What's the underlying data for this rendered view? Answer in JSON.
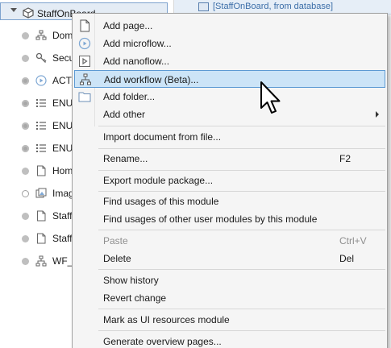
{
  "tree": {
    "root_label": "StaffOnBoard",
    "items": [
      {
        "label": "Dom",
        "icon": "domain-model-icon",
        "bullet": "gray"
      },
      {
        "label": "Secu",
        "icon": "security-key-icon",
        "bullet": "gray"
      },
      {
        "label": "ACT_",
        "icon": "microflow-icon",
        "bullet": "dark"
      },
      {
        "label": "ENU",
        "icon": "enumeration-icon",
        "bullet": "dark"
      },
      {
        "label": "ENU",
        "icon": "enumeration-icon",
        "bullet": "dark"
      },
      {
        "label": "ENU",
        "icon": "enumeration-icon",
        "bullet": "dark"
      },
      {
        "label": "Hom",
        "icon": "page-icon",
        "bullet": "gray"
      },
      {
        "label": "Imag",
        "icon": "image-collection-icon",
        "bullet": "hollow"
      },
      {
        "label": "Staff",
        "icon": "page-icon",
        "bullet": "gray"
      },
      {
        "label": "Staff",
        "icon": "page-icon",
        "bullet": "gray"
      },
      {
        "label": "WF_S",
        "icon": "workflow-icon",
        "bullet": "gray"
      }
    ]
  },
  "right_panel": {
    "breadcrumb": "[StaffOnBoard, from database]"
  },
  "menu": {
    "items": [
      {
        "label": "Add page...",
        "icon": "page-icon"
      },
      {
        "label": "Add microflow...",
        "icon": "microflow-icon"
      },
      {
        "label": "Add nanoflow...",
        "icon": "nanoflow-icon"
      },
      {
        "label": "Add workflow (Beta)...",
        "icon": "workflow-icon"
      },
      {
        "label": "Add folder...",
        "icon": "folder-icon"
      },
      {
        "label": "Add other"
      },
      {
        "label": "Import document from file..."
      },
      {
        "label": "Rename...",
        "shortcut": "F2"
      },
      {
        "label": "Export module package..."
      },
      {
        "label": "Find usages of this module"
      },
      {
        "label": "Find usages of other user modules by this module"
      },
      {
        "label": "Paste",
        "shortcut": "Ctrl+V"
      },
      {
        "label": "Delete",
        "shortcut": "Del"
      },
      {
        "label": "Show history"
      },
      {
        "label": "Revert change"
      },
      {
        "label": "Mark as UI resources module"
      },
      {
        "label": "Generate overview pages..."
      }
    ]
  },
  "colors": {
    "highlight": "#cce4f7",
    "highlight_border": "#5d9ad3",
    "disabled_text": "#8f8f8f",
    "link_blue": "#3c6ea8"
  }
}
